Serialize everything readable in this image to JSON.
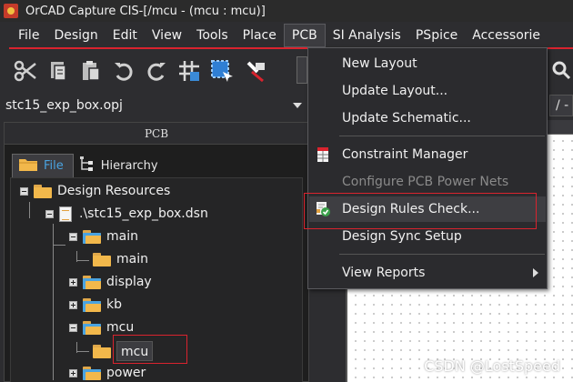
{
  "window": {
    "title": "OrCAD Capture CIS-[/mcu - (mcu : mcu)]"
  },
  "menubar": {
    "items": [
      "File",
      "Design",
      "Edit",
      "View",
      "Tools",
      "Place",
      "PCB",
      "SI Analysis",
      "PSpice",
      "Accessorie"
    ]
  },
  "toolbar": {
    "icons": [
      "scissors-icon",
      "copy-icon",
      "paste-icon",
      "undo-icon",
      "redo-icon",
      "grid-icon",
      "select-icon",
      "pin-icon"
    ]
  },
  "project": {
    "name": "stc15_exp_box.opj",
    "right_tab": "/ -"
  },
  "panel": {
    "title": "PCB",
    "tabs": [
      {
        "label": "File",
        "active": true
      },
      {
        "label": "Hierarchy",
        "active": false
      }
    ],
    "tree": {
      "root": "Design Resources",
      "design_file": ".\\stc15_exp_box.dsn",
      "nodes": [
        {
          "label": "main",
          "child": "main"
        },
        {
          "label": "display"
        },
        {
          "label": "kb"
        },
        {
          "label": "mcu",
          "child": "mcu"
        },
        {
          "label": "power"
        }
      ]
    }
  },
  "pcb_menu": {
    "items": [
      {
        "label": "New Layout",
        "disabled": false
      },
      {
        "label": "Update Layout...",
        "disabled": false
      },
      {
        "label": "Update Schematic...",
        "disabled": false
      },
      {
        "label": "Constraint Manager",
        "disabled": false,
        "icon": "spreadsheet-icon"
      },
      {
        "label": "Configure PCB Power Nets",
        "disabled": true
      },
      {
        "label": "Design Rules Check...",
        "disabled": false,
        "icon": "drc-check-icon",
        "highlighted": true
      },
      {
        "label": "Design Sync Setup",
        "disabled": false
      },
      {
        "label": "View Reports",
        "disabled": false,
        "submenu": true
      }
    ]
  },
  "watermark": "CSDN @LostSpeed",
  "colors": {
    "highlight_border": "#d9232e",
    "menu_bg": "#2b2b2e",
    "folder": "#f2b84b"
  }
}
